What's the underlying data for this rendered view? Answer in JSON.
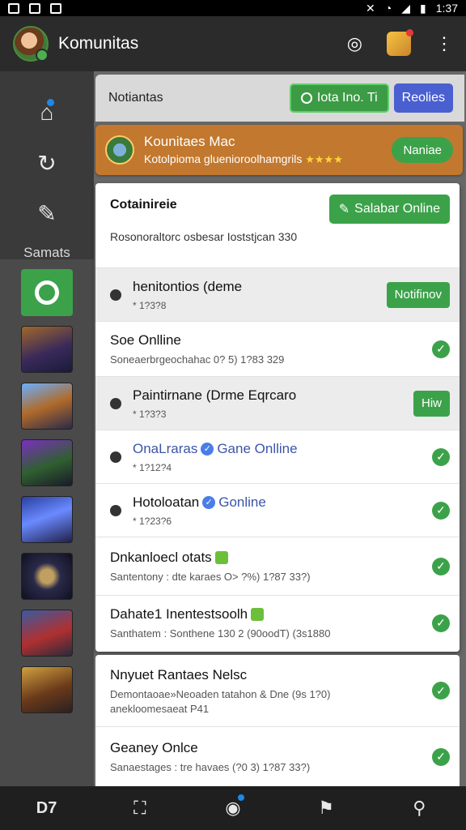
{
  "status_bar": {
    "time": "1:37"
  },
  "app_bar": {
    "title": "Komunitas"
  },
  "sidebar": {
    "label": "Samats"
  },
  "top_card": {
    "title": "Notiantas",
    "button_primary": "Iota Ino.  Ti",
    "button_secondary": "Reolies"
  },
  "banner": {
    "title": "Kounitaes Mac",
    "subtitle": "Kotolpioma gluenioroolhamgrils",
    "stars": "★★★★",
    "button": "Naniae"
  },
  "panel": {
    "title": "Cotainireie",
    "button": "Salabar Online",
    "subtitle": "Rosonoraltorc osbesar Ioststjcan 330",
    "rows": [
      {
        "title": "henitontios (deme",
        "meta": "* 1?3?8",
        "action": "Notifinov"
      },
      {
        "title": "Soe Onlline",
        "meta": "Soneaerbrgeochahac 0? 5) 1?83 329"
      },
      {
        "title": "Paintirnane (Drme Eqrcaro",
        "meta": "* 1?3?3",
        "action": "Hiw"
      },
      {
        "title": "OnaLraras",
        "status": "Gane Onlline",
        "meta": "* 1?12?4"
      },
      {
        "title": "Hotoloatan",
        "status": "Gonline",
        "meta": "* 1?23?6"
      },
      {
        "title": "Dnkanloecl otats",
        "meta": "Santentony : dte karaes O> ?%) 1?87 33?)"
      },
      {
        "title": "Dahate1 Inentestsoolh",
        "meta": "Santhatem : Sonthene 130 2 (90oodT) (3s1880"
      }
    ]
  },
  "card2": {
    "rows": [
      {
        "title": "Nnyuet Rantaes Nelsc",
        "meta": "Demontaoae»Neoaden tatahon & Dne (9s 1?0)",
        "meta2": "anekloomesaeat P41"
      },
      {
        "title": "Geaney Onlce",
        "meta": "Sanaestages : tre havaes (?0 3) 1?87 33?)"
      }
    ]
  },
  "bottom_nav": {
    "logo": "D7"
  }
}
